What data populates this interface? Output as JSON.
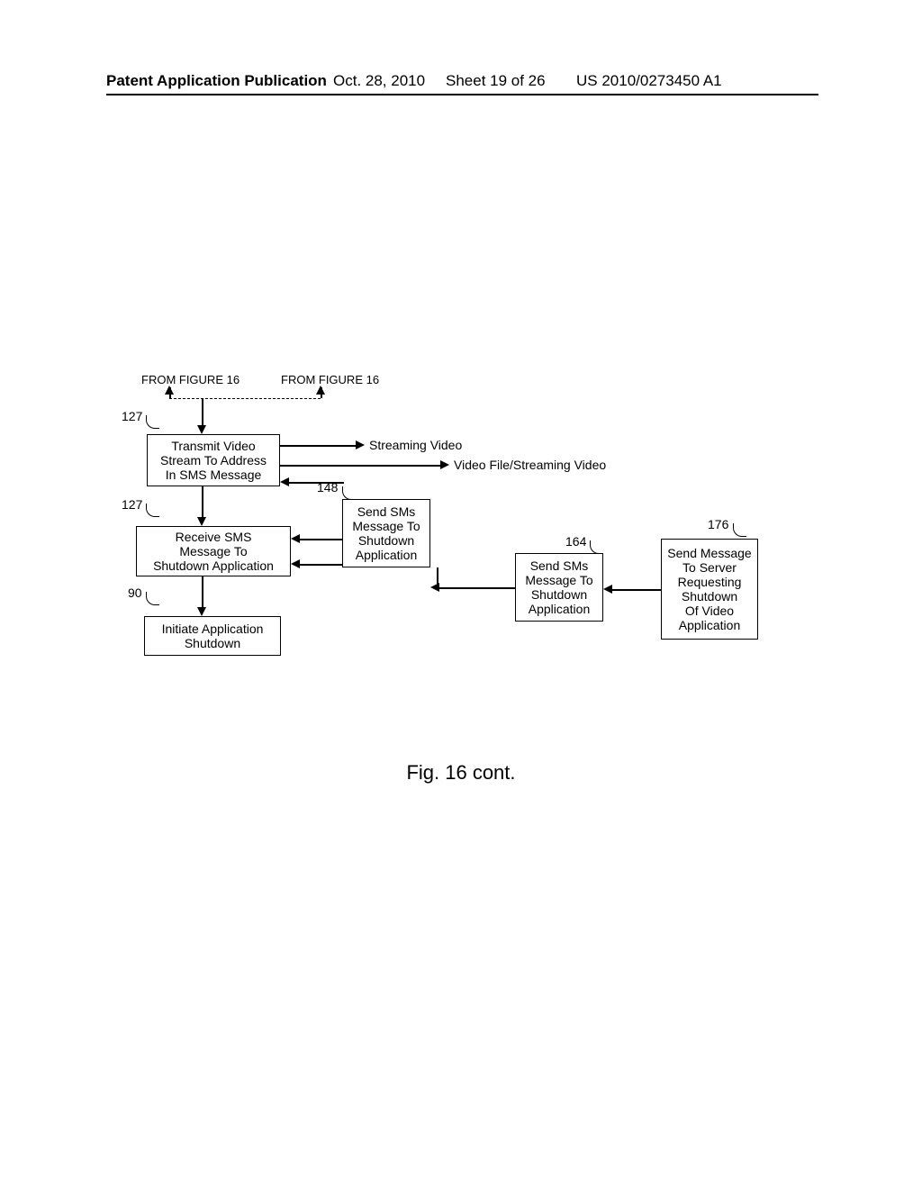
{
  "header": {
    "publication_label": "Patent Application Publication",
    "date": "Oct. 28, 2010",
    "sheet": "Sheet 19 of 26",
    "pub_number": "US 2010/0273450 A1"
  },
  "from_fig_left": "FROM FIGURE 16",
  "from_fig_right": "FROM FIGURE 16",
  "boxes": {
    "b127a": "Transmit Video\nStream To Address\nIn SMS Message",
    "b127b": "Receive SMS\nMessage To\nShutdown Application",
    "b90": "Initiate Application\nShutdown",
    "b148": "Send SMs\nMessage To\nShutdown\nApplication",
    "b164": "Send SMs\nMessage To\nShutdown\nApplication",
    "b176": "Send Message\nTo Server\nRequesting\nShutdown\nOf Video\nApplication"
  },
  "labels": {
    "sv": "Streaming Video",
    "vfsv": "Video File/Streaming Video"
  },
  "refs": {
    "r127a": "127",
    "r127b": "127",
    "r90": "90",
    "r148": "148",
    "r164": "164",
    "r176": "176"
  },
  "figure_caption": "Fig. 16 cont."
}
